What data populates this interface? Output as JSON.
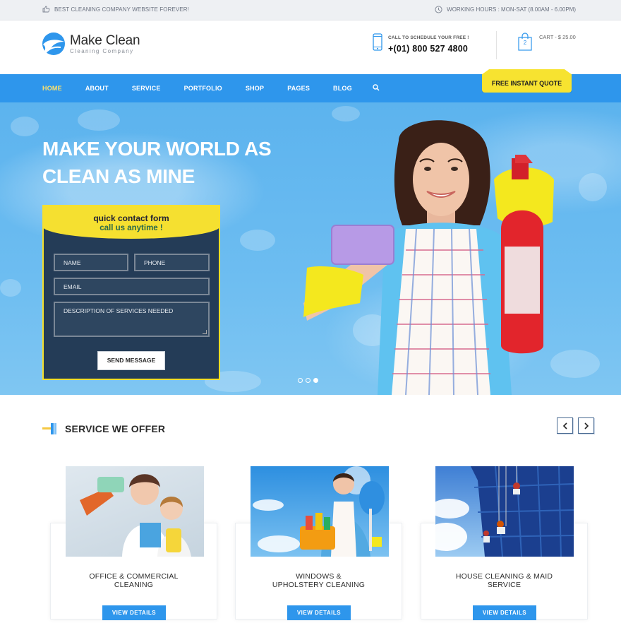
{
  "topbar": {
    "tagline": "BEST CLEANING COMPANY WEBSITE FOREVER!",
    "hours": "WORKING HOURS : MON-SAT (8.00AM - 6.00PM)"
  },
  "header": {
    "logo_name": "Make Clean",
    "logo_sub": "Cleaning Company",
    "phone_label": "CALL TO SCHEDULE YOUR FREE !",
    "phone_number": "+(01) 800 527 4800",
    "cart_count": "2",
    "cart_label": "CART - $ 25.00"
  },
  "nav": {
    "items": [
      "HOME",
      "ABOUT",
      "SERVICE",
      "PORTFOLIO",
      "SHOP",
      "PAGES",
      "BLOG"
    ],
    "active": "HOME",
    "quote_button": "FREE INSTANT QUOTE"
  },
  "hero": {
    "title_line1": "MAKE YOUR WORLD AS",
    "title_line2": "CLEAN AS MINE",
    "slider_dots": 3,
    "active_dot": 3
  },
  "form": {
    "heading": "quick contact form",
    "subheading": "call us anytime !",
    "name_placeholder": "NAME",
    "phone_placeholder": "PHONE",
    "email_placeholder": "EMAIL",
    "description_placeholder": "DESCRIPTION OF SERVICES NEEDED",
    "send_label": "SEND MESSAGE"
  },
  "services": {
    "title": "SERVICE WE OFFER",
    "cards": [
      {
        "title_line1": "OFFICE & COMMERCIAL",
        "title_line2": "CLEANING",
        "button": "VIEW DETAILS"
      },
      {
        "title_line1": "WINDOWS &",
        "title_line2": "UPHOLSTERY CLEANING",
        "button": "VIEW DETAILS"
      },
      {
        "title_line1": "HOUSE CLEANING & MAID",
        "title_line2": "SERVICE",
        "button": "VIEW DETAILS"
      }
    ]
  },
  "colors": {
    "brand_blue": "#2e96ec",
    "accent_yellow": "#f5e030",
    "form_bg": "#243c57"
  }
}
